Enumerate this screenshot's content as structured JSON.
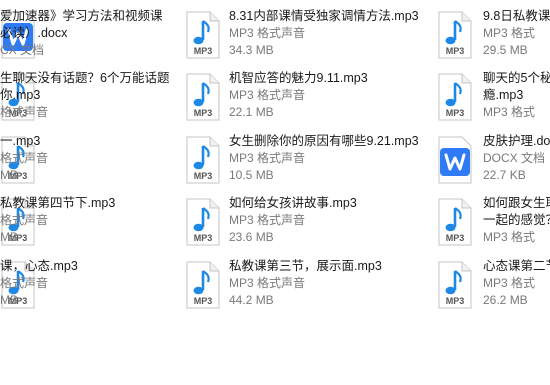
{
  "colors": {
    "mp3_note": "#1e88e5",
    "mp3_label": "#555555",
    "docx_brand": "#2f7bf5",
    "name_text": "#1a1a1a",
    "meta_text": "#7a7a7a"
  },
  "columns": [
    {
      "items": [
        {
          "icon": "docx-icon",
          "name_lines": [
            "爱加速器》学习方法和视频课",
            "必读）.docx"
          ],
          "type": "CX 文档",
          "size": ""
        },
        {
          "icon": "mp3-icon",
          "name_lines": [
            "生聊天没有话题？6个万能话题",
            "你.mp3"
          ],
          "type": "格式声音",
          "size": ""
        },
        {
          "icon": "mp3-icon",
          "name_lines": [
            "一.mp3"
          ],
          "type": "格式声音",
          "size": "MB"
        },
        {
          "icon": "mp3-icon",
          "name_lines": [
            "私教课第四节下.mp3"
          ],
          "type": "格式声音",
          "size": "MB"
        },
        {
          "icon": "mp3-icon",
          "name_lines": [
            "课，心态.mp3"
          ],
          "type": "格式声音",
          "size": "MB"
        }
      ]
    },
    {
      "items": [
        {
          "icon": "mp3-icon",
          "name_lines": [
            "8.31内部课情受独家调情方法.mp3"
          ],
          "type": "MP3 格式声音",
          "size": "34.3 MB"
        },
        {
          "icon": "mp3-icon",
          "name_lines": [
            "机智应答的魅力9.11.mp3"
          ],
          "type": "MP3 格式声音",
          "size": "22.1 MB"
        },
        {
          "icon": "mp3-icon",
          "name_lines": [
            "女生删除你的原因有哪些9.21.mp3"
          ],
          "type": "MP3 格式声音",
          "size": "10.5 MB"
        },
        {
          "icon": "mp3-icon",
          "name_lines": [
            "如何给女孩讲故事.mp3"
          ],
          "type": "MP3 格式声音",
          "size": "23.6 MB"
        },
        {
          "icon": "mp3-icon",
          "name_lines": [
            "私教课第三节，展示面.mp3"
          ],
          "type": "MP3 格式声音",
          "size": "44.2 MB"
        }
      ]
    },
    {
      "items": [
        {
          "icon": "mp3-icon",
          "name_lines": [
            "9.8日私教课"
          ],
          "type": "MP3 格式",
          "size": "29.5 MB"
        },
        {
          "icon": "mp3-icon",
          "name_lines": [
            "聊天的5个秘",
            "瘾.mp3"
          ],
          "type": "MP3 格式",
          "size": ""
        },
        {
          "icon": "docx-icon",
          "name_lines": [
            "皮肤护理.do"
          ],
          "type": "DOCX 文档",
          "size": "22.7 KB"
        },
        {
          "icon": "mp3-icon",
          "name_lines": [
            "如何跟女生耶",
            "一起的感觉？"
          ],
          "type": "MP3 格式",
          "size": ""
        },
        {
          "icon": "mp3-icon",
          "name_lines": [
            "心态课第二节"
          ],
          "type": "MP3 格式",
          "size": "26.2 MB"
        }
      ]
    }
  ]
}
